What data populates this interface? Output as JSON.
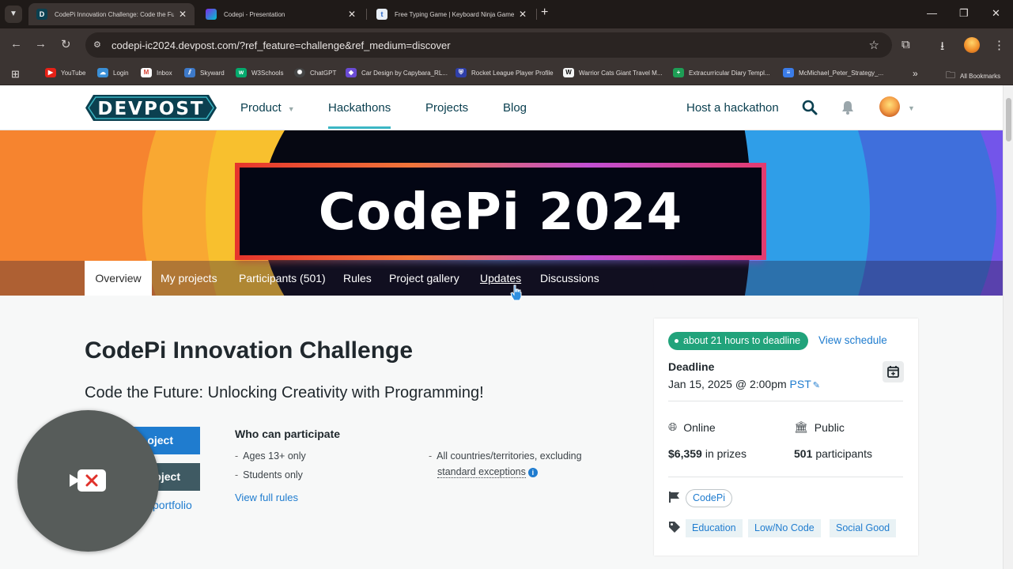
{
  "browser": {
    "tabs": [
      {
        "favicon": "devpost-icon",
        "favicon_text": "D",
        "title": "CodePi Innovation Challenge: Code the Fu",
        "active": true
      },
      {
        "favicon": "canva-icon",
        "favicon_text": "",
        "title": "Codepi - Presentation",
        "active": false
      },
      {
        "favicon": "typing-icon",
        "favicon_text": "t",
        "title": "Free Typing Game | Keyboard Ninja Game",
        "active": false
      }
    ],
    "url": "codepi-ic2024.devpost.com/?ref_feature=challenge&ref_medium=discover",
    "bookmarks": [
      {
        "label": "YouTube",
        "icon": "youtube-icon",
        "color": "#e62117"
      },
      {
        "label": "Login",
        "icon": "cloud-icon",
        "color": "#3a8fd6"
      },
      {
        "label": "Inbox",
        "icon": "gmail-icon",
        "color": "#d64437"
      },
      {
        "label": "Skyward",
        "icon": "skyward-icon",
        "color": "#3d79c9"
      },
      {
        "label": "W3Schools",
        "icon": "w3schools-icon",
        "color": "#04aa6d"
      },
      {
        "label": "ChatGPT",
        "icon": "chatgpt-icon",
        "color": "#444444"
      },
      {
        "label": "Car Design by Capybara_RL...",
        "icon": "car-icon",
        "color": "#6a4bd4"
      },
      {
        "label": "Rocket League Player Profile",
        "icon": "shield-icon",
        "color": "#2f3fa8"
      },
      {
        "label": "Warrior Cats Giant Travel M...",
        "icon": "wikipedia-icon",
        "color": "#f5f5f5"
      },
      {
        "label": "Extracurricular Diary Templ...",
        "icon": "sheets-icon",
        "color": "#1e9e55"
      },
      {
        "label": "McMichael_Peter_Strategy_...",
        "icon": "docs-icon",
        "color": "#3b7ce8"
      }
    ],
    "all_bookmarks": "All Bookmarks"
  },
  "header": {
    "logo": "DEVPOST",
    "nav": [
      "Product",
      "Hackathons",
      "Projects",
      "Blog"
    ],
    "host": "Host a hackathon"
  },
  "banner": {
    "title": "CodePi 2024"
  },
  "subnav": {
    "tabs": [
      "Overview",
      "My projects",
      "Participants (501)",
      "Rules",
      "Project gallery",
      "Updates",
      "Discussions"
    ]
  },
  "main": {
    "title": "CodePi Innovation Challenge",
    "tagline": "Code the Future: Unlocking Creativity with Programming!",
    "primary_button": "oject",
    "secondary_button": "oject",
    "portfolio_link": "portfolio",
    "who_title": "Who can participate",
    "who_items": [
      "Ages 13+ only",
      "Students only"
    ],
    "who_regions_line1": "All countries/territories, excluding",
    "who_regions_line2": "standard exceptions",
    "rules_link": "View full rules"
  },
  "sidebar": {
    "deadline_pill": "about 21 hours to deadline",
    "schedule_link": "View schedule",
    "deadline_label": "Deadline",
    "deadline_date": "Jan 15, 2025 @ 2:00pm",
    "deadline_tz": "PST",
    "location": "Online",
    "visibility": "Public",
    "prize_amount": "$6,359",
    "prize_suffix": "in prizes",
    "participant_count": "501",
    "participant_suffix": "participants",
    "managed_by": "CodePi",
    "themes": [
      "Education",
      "Low/No Code",
      "Social Good"
    ]
  },
  "colors": {
    "brand_teal": "#0b4050",
    "accent_teal": "#3bb6c4",
    "link_blue": "#1f7ccf",
    "deadline_green": "#21a37b"
  }
}
